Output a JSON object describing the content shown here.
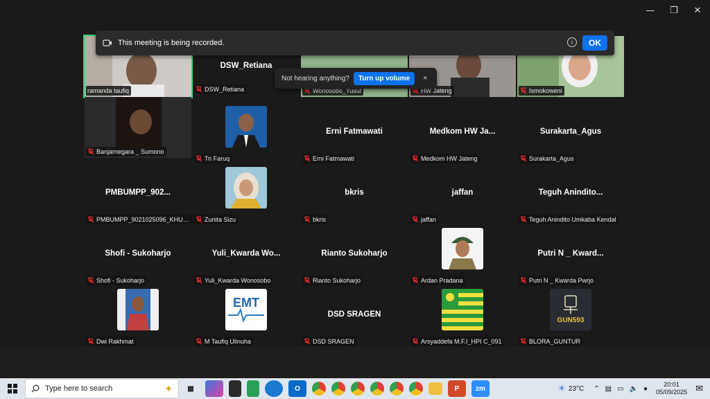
{
  "window": {
    "controls": [
      "minimize-icon",
      "restore-icon",
      "close-icon"
    ]
  },
  "recording_banner": {
    "text": "This meeting is being recorded.",
    "ok_label": "OK",
    "info_icon": "i"
  },
  "audio_prompt": {
    "text": "Not hearing anything?",
    "button": "Turn up volume",
    "close": "×"
  },
  "participants": [
    {
      "label": "ramanda taufiq",
      "center": "",
      "video": true
    },
    {
      "label": "DSW_Retiana",
      "center": "DSW_Retiana",
      "video": false
    },
    {
      "label": "Wonosobo_Yusuf",
      "center": "",
      "video": true
    },
    {
      "label": "HW Jateng",
      "center": "",
      "video": true
    },
    {
      "label": "Ismokoweni",
      "center": "",
      "video": true
    },
    {
      "label": "Banjarnegara _ Sumono",
      "center": "",
      "video": true
    },
    {
      "label": "Tri Faruq",
      "center": "",
      "photo": true
    },
    {
      "label": "Erni Fatmawati",
      "center": "Erni Fatmawati"
    },
    {
      "label": "Medkom HW Jateng",
      "center": "Medkom  HW  Ja..."
    },
    {
      "label": "Surakarta_Agus",
      "center": "Surakarta_Agus"
    },
    {
      "label": "PMBUMPP_9021025096_KHUS...",
      "center": "PMBUMPP_902..."
    },
    {
      "label": "Zunita Sizu",
      "center": "",
      "photo": true
    },
    {
      "label": "bkris",
      "center": "bkris"
    },
    {
      "label": "jaffan",
      "center": "jaffan"
    },
    {
      "label": "Teguh Anindito Umkaba Kendal",
      "center": "Teguh  Anindito..."
    },
    {
      "label": "Shofi - Sukoharjo",
      "center": "Shofi - Sukoharjo"
    },
    {
      "label": "Yuli_Kwarda Wonosobo",
      "center": "Yuli_Kwarda  Wo..."
    },
    {
      "label": "Rianto Sukoharjo",
      "center": "Rianto Sukoharjo"
    },
    {
      "label": "Ardan Pradana",
      "center": "",
      "photo": true
    },
    {
      "label": "Putri N _ Kwarda Pwrjo",
      "center": "Putri N _ Kward..."
    },
    {
      "label": "Dwi Rakhmat",
      "center": "",
      "photo": true
    },
    {
      "label": "M Taufiq Ulinuha",
      "center": "",
      "photo": true,
      "logo_text": "EMT"
    },
    {
      "label": "DSD SRAGEN",
      "center": "DSD SRAGEN"
    },
    {
      "label": "Arsyaddefa M.F.I_HPI C_091",
      "center": "",
      "photo": true
    },
    {
      "label": "BLORA_GUNTUR",
      "center": "",
      "photo": true,
      "logo_text": "GUN593"
    }
  ],
  "taskbar": {
    "search_placeholder": "Type here to search",
    "weather": "23°C",
    "time": "20:01",
    "date": "05/09/2025",
    "app_icons": [
      "task-view-icon",
      "copilot-icon",
      "app-icon",
      "app-icon",
      "edge-icon",
      "outlook-icon",
      "chrome-icon",
      "chrome-icon",
      "chrome-icon",
      "chrome-icon",
      "chrome-icon",
      "chrome-icon",
      "file-explorer-icon",
      "powerpoint-icon",
      "zoom-icon"
    ]
  }
}
